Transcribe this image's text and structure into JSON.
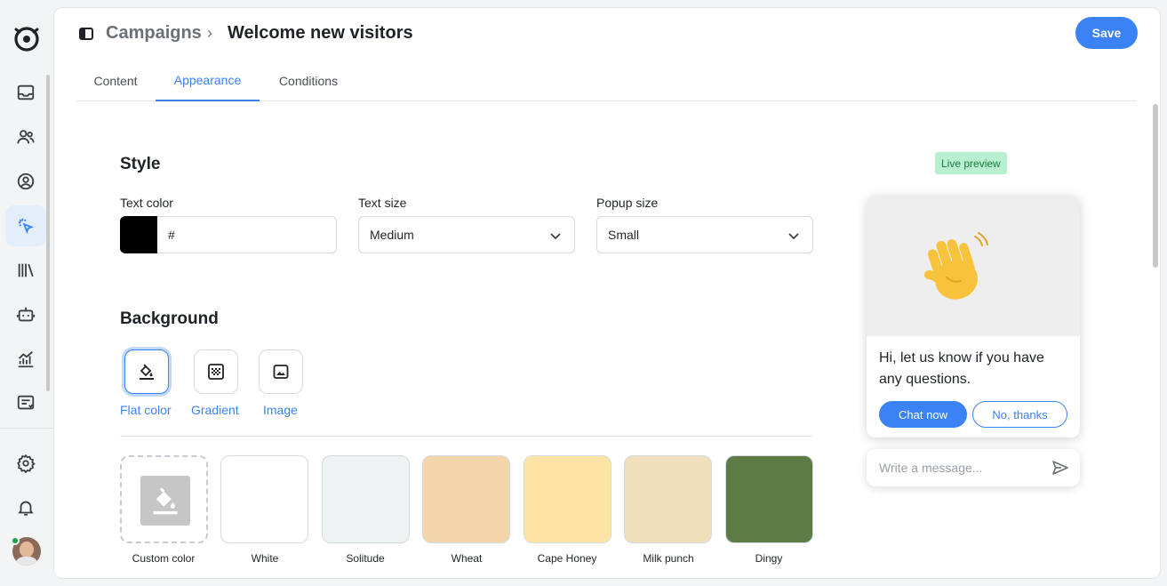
{
  "breadcrumb": {
    "parent": "Campaigns",
    "separator": "›",
    "current": "Welcome new visitors"
  },
  "header": {
    "save_label": "Save"
  },
  "tabs": [
    {
      "label": "Content",
      "active": false
    },
    {
      "label": "Appearance",
      "active": true
    },
    {
      "label": "Conditions",
      "active": false
    }
  ],
  "style": {
    "title": "Style",
    "text_color": {
      "label": "Text color",
      "value": "#",
      "swatch": "#000000"
    },
    "text_size": {
      "label": "Text size",
      "value": "Medium"
    },
    "popup_size": {
      "label": "Popup size",
      "value": "Small"
    }
  },
  "background": {
    "title": "Background",
    "types": [
      {
        "label": "Flat color",
        "icon": "paint-bucket-icon",
        "active": true
      },
      {
        "label": "Gradient",
        "icon": "gradient-icon",
        "active": false
      },
      {
        "label": "Image",
        "icon": "image-icon",
        "active": false
      }
    ],
    "swatches": [
      {
        "label": "Custom color",
        "color": ""
      },
      {
        "label": "White",
        "color": "#ffffff"
      },
      {
        "label": "Solitude",
        "color": "#edf3f3"
      },
      {
        "label": "Wheat",
        "color": "#f3d5ac"
      },
      {
        "label": "Cape Honey",
        "color": "#fde3a6"
      },
      {
        "label": "Milk punch",
        "color": "#efdfba"
      },
      {
        "label": "Dingy",
        "color": "#5d7c45"
      }
    ]
  },
  "preview": {
    "badge": "Live preview",
    "message": "Hi, let us know if you have any questions.",
    "primary_button": "Chat now",
    "secondary_button": "No, thanks",
    "input_placeholder": "Write a message..."
  },
  "colors": {
    "accent": "#3b82f6",
    "badge_bg": "#b9f0cf",
    "badge_text": "#197a42"
  }
}
